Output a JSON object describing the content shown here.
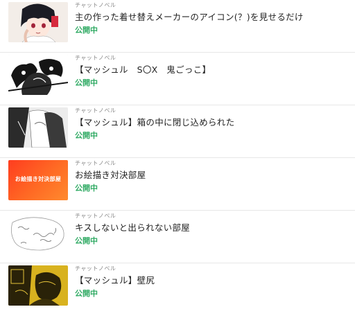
{
  "colors": {
    "status": "#2faa63",
    "divider": "#e7e7e7",
    "orange_thumb": "#ff5a1f"
  },
  "items": [
    {
      "kind": "チャットノベル",
      "title": "主の作った着せ替えメーカーのアイコン(？)を見せるだけ",
      "status": "公開中"
    },
    {
      "kind": "チャットノベル",
      "title": "【マッシュル　S〇X　鬼ごっこ】",
      "status": "公開中"
    },
    {
      "kind": "チャットノベル",
      "title": "【マッシュル】箱の中に閉じ込められた",
      "status": "公開中"
    },
    {
      "kind": "チャットノベル",
      "title": "お絵描き対決部屋",
      "status": "公開中",
      "thumb_text": "お絵描き対決部屋"
    },
    {
      "kind": "チャットノベル",
      "title": "キスしないと出られない部屋",
      "status": "公開中"
    },
    {
      "kind": "チャットノベル",
      "title": "【マッシュル】壁尻",
      "status": "公開中"
    }
  ]
}
